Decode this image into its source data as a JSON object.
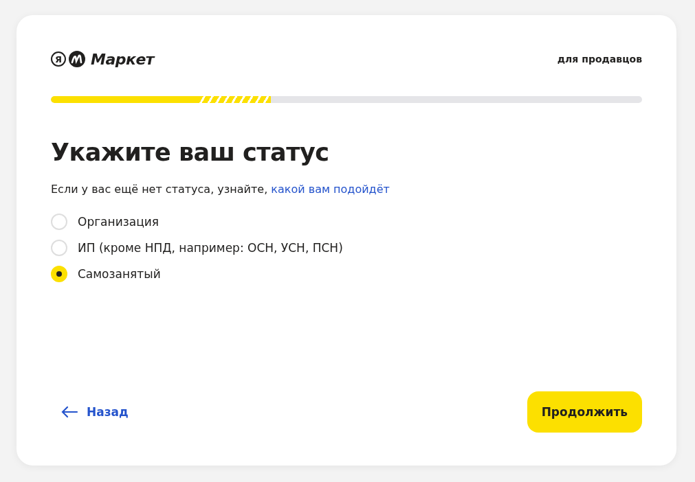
{
  "header": {
    "logo_letter": "Я",
    "logo_text": "Маркет",
    "link": "для продавцов"
  },
  "progress": {
    "level": 0.25
  },
  "title": "Укажите ваш статус",
  "subtitle": {
    "text": "Если у вас ещё нет статуса, узнайте, ",
    "link": "какой вам подойдёт"
  },
  "options": [
    {
      "label": "Организация",
      "selected": false
    },
    {
      "label": "ИП (кроме НПД, например: ОСН, УСН, ПСН)",
      "selected": false
    },
    {
      "label": "Самозанятый",
      "selected": true
    }
  ],
  "back_button": "Назад",
  "continue_button": "Продолжить"
}
